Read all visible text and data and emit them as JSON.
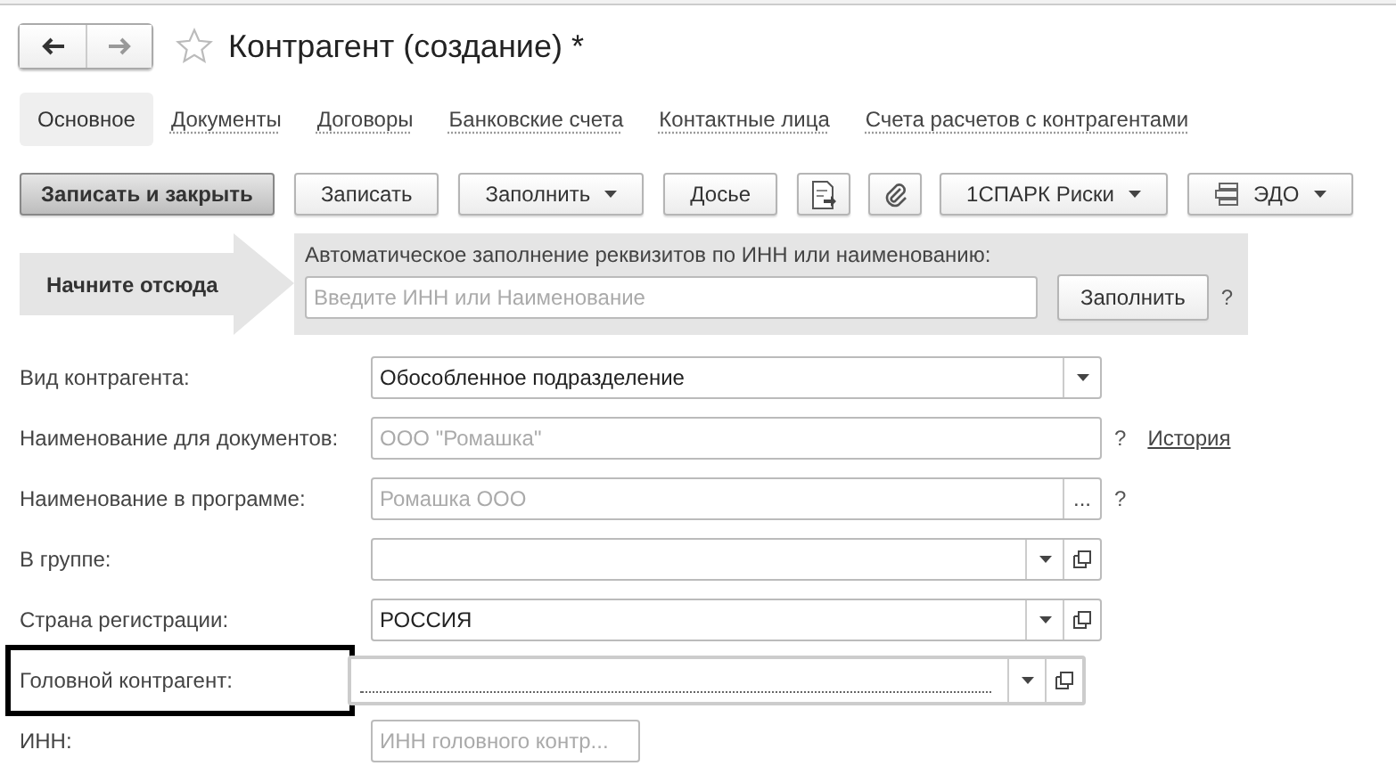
{
  "window": {
    "title": "Контрагент (создание) *",
    "favorite": false
  },
  "tabs": [
    {
      "label": "Основное",
      "selected": true
    },
    {
      "label": "Документы",
      "selected": false
    },
    {
      "label": "Договоры",
      "selected": false
    },
    {
      "label": "Банковские счета",
      "selected": false
    },
    {
      "label": "Контактные лица",
      "selected": false
    },
    {
      "label": "Счета расчетов с контрагентами",
      "selected": false
    }
  ],
  "toolbar": [
    {
      "kind": "primary",
      "label": "Записать и закрыть"
    },
    {
      "kind": "button",
      "label": "Записать"
    },
    {
      "kind": "menu",
      "label": "Заполнить"
    },
    {
      "kind": "button",
      "label": "Досье"
    },
    {
      "kind": "report"
    },
    {
      "kind": "attach"
    },
    {
      "kind": "menu",
      "label": "1СПАРК Риски"
    },
    {
      "kind": "edo-menu",
      "label": "ЭДО"
    }
  ],
  "banner": {
    "label": "Начните отсюда",
    "caption": "Автоматическое заполнение реквизитов по ИНН или наименованию:",
    "placeholder": "Введите ИНН или Наименование",
    "button": "Заполнить",
    "help": "?"
  },
  "fields": [
    {
      "label": "Вид контрагента:",
      "kind": "select",
      "value": "Обособленное подразделение",
      "highlighted": false,
      "focused": false
    },
    {
      "label": "Наименование для документов:",
      "kind": "text",
      "placeholder": "ООО \"Ромашка\"",
      "help": "?",
      "link": "История",
      "highlighted": false,
      "focused": false
    },
    {
      "label": "Наименование в программе:",
      "kind": "choice",
      "placeholder": "Ромашка ООО",
      "button": "...",
      "help": "?",
      "highlighted": false,
      "focused": false
    },
    {
      "label": "В группе:",
      "kind": "combo",
      "highlighted": false,
      "focused": false
    },
    {
      "label": "Страна регистрации:",
      "kind": "combo",
      "value": "РОССИЯ",
      "highlighted": false,
      "focused": false
    },
    {
      "label": "Головной контрагент:",
      "kind": "combo",
      "highlighted": true,
      "focused": true
    },
    {
      "label": "ИНН:",
      "kind": "short",
      "placeholder": "ИНН головного контр...",
      "highlighted": false,
      "focused": false
    }
  ]
}
